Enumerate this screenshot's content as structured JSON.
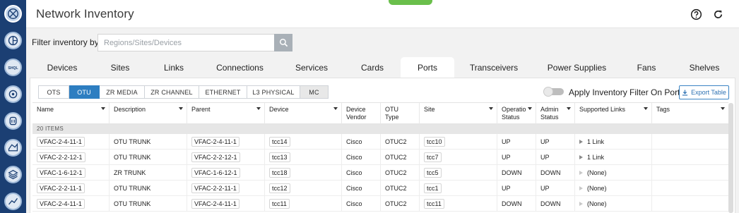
{
  "colors": {
    "rail": "#1b3f73",
    "accent": "#2d7ec1",
    "notch": "#6abf4b"
  },
  "rail": {
    "icons": [
      "globe-icon",
      "planner-icon",
      "sql-icon",
      "topology-icon",
      "mc-icon",
      "map-icon",
      "layers-icon",
      "analytics-icon"
    ],
    "sql_text": "SHQL"
  },
  "header": {
    "title": "Network Inventory",
    "help_icon": "help-circle-icon",
    "refresh_icon": "refresh-icon"
  },
  "filter": {
    "label": "Filter inventory by:",
    "placeholder": "Regions/Sites/Devices",
    "value": ""
  },
  "tabs": [
    "Devices",
    "Sites",
    "Links",
    "Connections",
    "Services",
    "Cards",
    "Ports",
    "Transceivers",
    "Power Supplies",
    "Fans",
    "Shelves"
  ],
  "active_tab": "Ports",
  "subtabs": [
    "OTS",
    "OTU",
    "ZR MEDIA",
    "ZR CHANNEL",
    "ETHERNET",
    "L3 PHYSICAL",
    "MC"
  ],
  "active_subtab": "OTU",
  "toggle": {
    "label": "Apply Inventory Filter On Ports",
    "on": false
  },
  "export": {
    "label": "Export Table"
  },
  "columns": [
    {
      "line1": "Name",
      "line2": ""
    },
    {
      "line1": "Description",
      "line2": ""
    },
    {
      "line1": "Parent",
      "line2": ""
    },
    {
      "line1": "Device",
      "line2": ""
    },
    {
      "line1": "Device",
      "line2": "Vendor"
    },
    {
      "line1": "OTU",
      "line2": "Type"
    },
    {
      "line1": "Site",
      "line2": ""
    },
    {
      "line1": "Operatio",
      "line2": "Status"
    },
    {
      "line1": "Admin",
      "line2": "Status"
    },
    {
      "line1": "Supported Links",
      "line2": ""
    },
    {
      "line1": "Tags",
      "line2": ""
    }
  ],
  "group_label": "20 ITEMS",
  "rows": [
    {
      "name": "VFAC-2-4-11-1",
      "description": "OTU TRUNK",
      "parent": "VFAC-2-4-11-1",
      "device": "tcc14",
      "vendor": "Cisco",
      "otu_type": "OTUC2",
      "site": "tcc10",
      "oper_status": "UP",
      "admin_status": "UP",
      "links": "1 Link",
      "tags": ""
    },
    {
      "name": "VFAC-2-2-12-1",
      "description": "OTU TRUNK",
      "parent": "VFAC-2-2-12-1",
      "device": "tcc13",
      "vendor": "Cisco",
      "otu_type": "OTUC2",
      "site": "tcc7",
      "oper_status": "UP",
      "admin_status": "UP",
      "links": "1 Link",
      "tags": ""
    },
    {
      "name": "VFAC-1-6-12-1",
      "description": "ZR TRUNK",
      "parent": "VFAC-1-6-12-1",
      "device": "tcc18",
      "vendor": "Cisco",
      "otu_type": "OTUC2",
      "site": "tcc5",
      "oper_status": "DOWN",
      "admin_status": "DOWN",
      "links": "(None)",
      "tags": ""
    },
    {
      "name": "VFAC-2-2-11-1",
      "description": "OTU TRUNK",
      "parent": "VFAC-2-2-11-1",
      "device": "tcc12",
      "vendor": "Cisco",
      "otu_type": "OTUC2",
      "site": "tcc1",
      "oper_status": "UP",
      "admin_status": "UP",
      "links": "(None)",
      "tags": ""
    },
    {
      "name": "VFAC-2-4-11-1",
      "description": "OTU TRUNK",
      "parent": "VFAC-2-4-11-1",
      "device": "tcc11",
      "vendor": "Cisco",
      "otu_type": "OTUC2",
      "site": "tcc11",
      "oper_status": "DOWN",
      "admin_status": "DOWN",
      "links": "(None)",
      "tags": ""
    }
  ]
}
